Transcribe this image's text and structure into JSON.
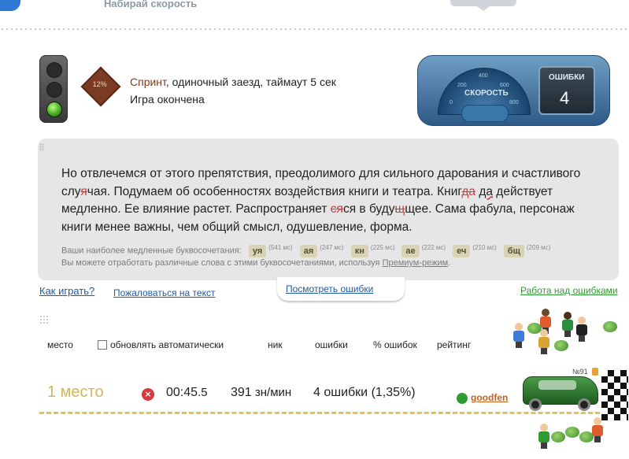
{
  "header": {
    "tagline": "Набирай скорость"
  },
  "game": {
    "mode": "Спринт",
    "mode_rest": ", одиночный заезд, таймаут 5 сек",
    "status": "Игра окончена",
    "sprint_icon_label": "12%"
  },
  "dashboard": {
    "speed_label": "СКОРОСТЬ",
    "gauge_ticks": [
      "0",
      "200",
      "400",
      "600",
      "800"
    ],
    "errors_label": "ОШИБКИ",
    "errors_count": "4"
  },
  "text": {
    "p1": "Но отвлечемся от этого препятствия, преодолимого для сильного дарования и счастливого слу",
    "e1": "я",
    "p2": "чая. Подумаем об особенностях воздействия книги и театра. Книг",
    "e2": "да",
    "e3": "да",
    "p3": " действует медленно. Ее влияние растет. Распространяет",
    "e4": "ся",
    "p4": "ся в буду",
    "e5": "щ",
    "p5": "щее. Сама фабула, персонаж книги менее важны, чем общий смысл, одушевление, форма."
  },
  "slow_combos": {
    "intro": "Ваши наиболее медленные буквосочетания:",
    "items": [
      {
        "combo": "уя",
        "ms": "(541 мс)"
      },
      {
        "combo": "ая",
        "ms": "(247 мс)"
      },
      {
        "combo": "кн",
        "ms": "(225 мс)"
      },
      {
        "combo": "ае",
        "ms": "(222 мс)"
      },
      {
        "combo": "еч",
        "ms": "(210 мс)"
      },
      {
        "combo": "бщ",
        "ms": "(209 мс)"
      }
    ],
    "premium_text": "Вы можете отработать различные слова с этими буквосочетаниями, используя ",
    "premium_link": "Премиум-режим",
    "premium_end": "."
  },
  "links": {
    "how_to_play": "Как играть?",
    "complain": "Пожаловаться на текст",
    "see_errors": "Посмотреть ошибки",
    "work_on_errors": "Работа над ошибками"
  },
  "columns": {
    "place": "место",
    "auto_update": "обновлять автоматически",
    "nick": "ник",
    "errors": "ошибки",
    "error_percent": "% ошибок",
    "rating": "рейтинг"
  },
  "result": {
    "place": "1 место",
    "time_main": "00:45",
    "time_frac": ".5",
    "speed_value": "391",
    "speed_unit": " зн/мин",
    "errors": "4 ошибки (1,35%)",
    "nick": "goodfen",
    "car_number": "№91"
  },
  "colors": {
    "link": "#1f5ba8",
    "green_link": "#2e9c2e",
    "place_gold": "#d4b65a",
    "error_red": "#d43b3b",
    "nick_orange": "#c2611b"
  }
}
